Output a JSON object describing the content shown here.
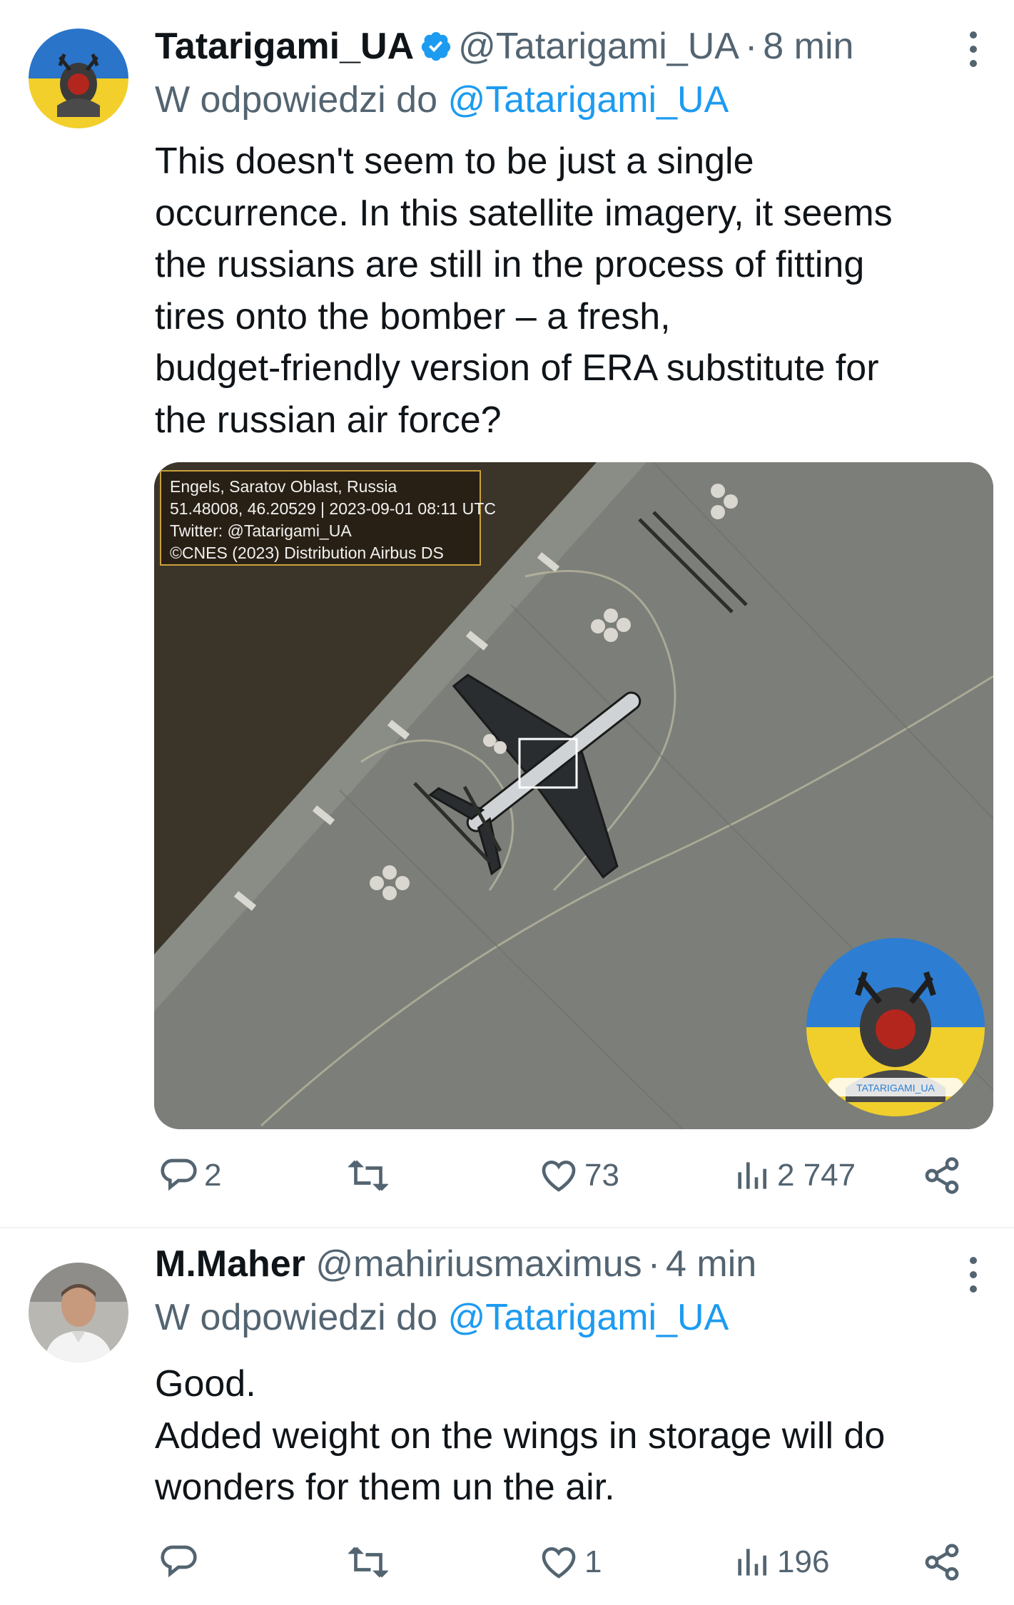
{
  "tweets": [
    {
      "display_name": "Tatarigami_UA",
      "handle": "@Tatarigami_UA",
      "separator": "·",
      "time": "8 min",
      "reply_prefix": "W odpowiedzi do",
      "reply_to": "@Tatarigami_UA",
      "text_lines": [
        "This doesn't seem to be just a single",
        "occurrence. In this satellite imagery, it seems",
        "the russians are still in the process of fitting",
        "tires onto the bomber – a fresh,",
        "budget-friendly version of ERA substitute for",
        "the russian air force?"
      ],
      "media": {
        "caption_lines": [
          "Engels, Saratov Oblast, Russia",
          "51.48008, 46.20529 | 2023-09-01 08:11 UTC",
          "Twitter: @Tatarigami_UA",
          "©CNES (2023) Distribution Airbus DS"
        ],
        "watermark": "TATARIGAMI_UA"
      },
      "stats": {
        "replies": "2",
        "reposts": "",
        "likes": "73",
        "views": "2 747"
      }
    },
    {
      "display_name": "M.Maher",
      "handle": "@mahiriusmaximus",
      "separator": "·",
      "time": "4 min",
      "reply_prefix": "W odpowiedzi do",
      "reply_to": "@Tatarigami_UA",
      "text_lines": [
        "Good.",
        "Added weight on the wings in storage will do",
        "wonders for them un the air."
      ],
      "stats": {
        "replies": "",
        "reposts": "",
        "likes": "1",
        "views": "196"
      }
    }
  ],
  "colors": {
    "accent": "#1d9bf0",
    "muted": "#536471",
    "text": "#0f1419",
    "divider": "#eff3f4"
  },
  "icons": [
    "verified-badge-icon",
    "more-options-icon",
    "reply-icon",
    "repost-icon",
    "like-icon",
    "views-icon",
    "share-icon"
  ]
}
